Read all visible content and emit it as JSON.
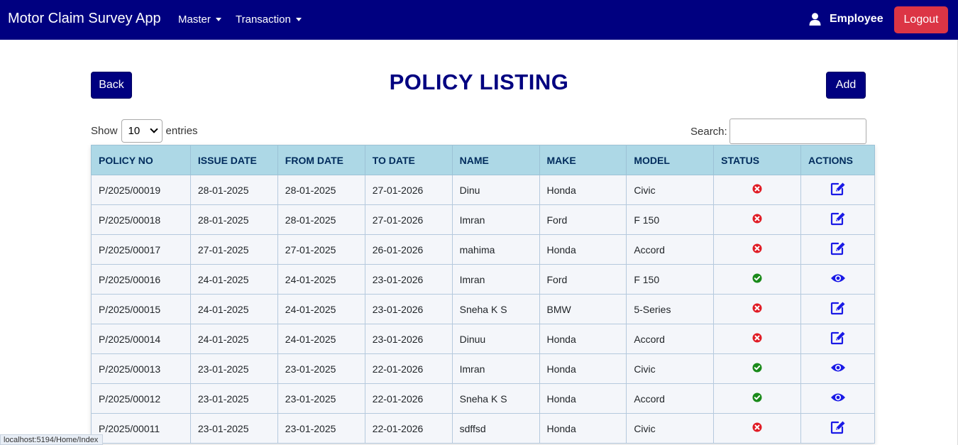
{
  "app_title": "Motor Claim Survey App",
  "nav": {
    "master": "Master",
    "transaction": "Transaction"
  },
  "user": {
    "name": "Employee",
    "icon": "user-icon"
  },
  "logout_label": "Logout",
  "buttons": {
    "back": "Back",
    "add": "Add"
  },
  "page_title": "POLICY LISTING",
  "length_menu": {
    "show": "Show",
    "value": "10",
    "entries": "entries"
  },
  "search": {
    "label": "Search:",
    "value": ""
  },
  "table": {
    "headers": [
      "POLICY NO",
      "ISSUE DATE",
      "FROM DATE",
      "TO DATE",
      "NAME",
      "MAKE",
      "MODEL",
      "STATUS",
      "ACTIONS"
    ],
    "rows": [
      {
        "policy_no": "P/2025/00019",
        "issue_date": "28-01-2025",
        "from_date": "28-01-2025",
        "to_date": "27-01-2026",
        "name": "Dinu",
        "make": "Honda",
        "model": "Civic",
        "status": "inactive",
        "action": "edit"
      },
      {
        "policy_no": "P/2025/00018",
        "issue_date": "28-01-2025",
        "from_date": "28-01-2025",
        "to_date": "27-01-2026",
        "name": "Imran",
        "make": "Ford",
        "model": "F 150",
        "status": "inactive",
        "action": "edit"
      },
      {
        "policy_no": "P/2025/00017",
        "issue_date": "27-01-2025",
        "from_date": "27-01-2025",
        "to_date": "26-01-2026",
        "name": "mahima",
        "make": "Honda",
        "model": "Accord",
        "status": "inactive",
        "action": "edit"
      },
      {
        "policy_no": "P/2025/00016",
        "issue_date": "24-01-2025",
        "from_date": "24-01-2025",
        "to_date": "23-01-2026",
        "name": "Imran",
        "make": "Ford",
        "model": "F 150",
        "status": "active",
        "action": "view"
      },
      {
        "policy_no": "P/2025/00015",
        "issue_date": "24-01-2025",
        "from_date": "24-01-2025",
        "to_date": "23-01-2026",
        "name": "Sneha K S",
        "make": "BMW",
        "model": "5-Series",
        "status": "inactive",
        "action": "edit"
      },
      {
        "policy_no": "P/2025/00014",
        "issue_date": "24-01-2025",
        "from_date": "24-01-2025",
        "to_date": "23-01-2026",
        "name": "Dinuu",
        "make": "Honda",
        "model": "Accord",
        "status": "inactive",
        "action": "edit"
      },
      {
        "policy_no": "P/2025/00013",
        "issue_date": "23-01-2025",
        "from_date": "23-01-2025",
        "to_date": "22-01-2026",
        "name": "Imran",
        "make": "Honda",
        "model": "Civic",
        "status": "active",
        "action": "view"
      },
      {
        "policy_no": "P/2025/00012",
        "issue_date": "23-01-2025",
        "from_date": "23-01-2025",
        "to_date": "22-01-2026",
        "name": "Sneha K S",
        "make": "Honda",
        "model": "Accord",
        "status": "active",
        "action": "view"
      },
      {
        "policy_no": "P/2025/00011",
        "issue_date": "23-01-2025",
        "from_date": "23-01-2025",
        "to_date": "22-01-2026",
        "name": "sdffsd",
        "make": "Honda",
        "model": "Civic",
        "status": "inactive",
        "action": "edit"
      }
    ]
  },
  "status_bar_url": "localhost:5194/Home/Index",
  "colors": {
    "navbar": "#000080",
    "logout": "#dc3545",
    "header_bg": "#add8e6",
    "active": "#1a8a1a",
    "inactive": "#e01b24",
    "action": "#1a1ae6"
  }
}
